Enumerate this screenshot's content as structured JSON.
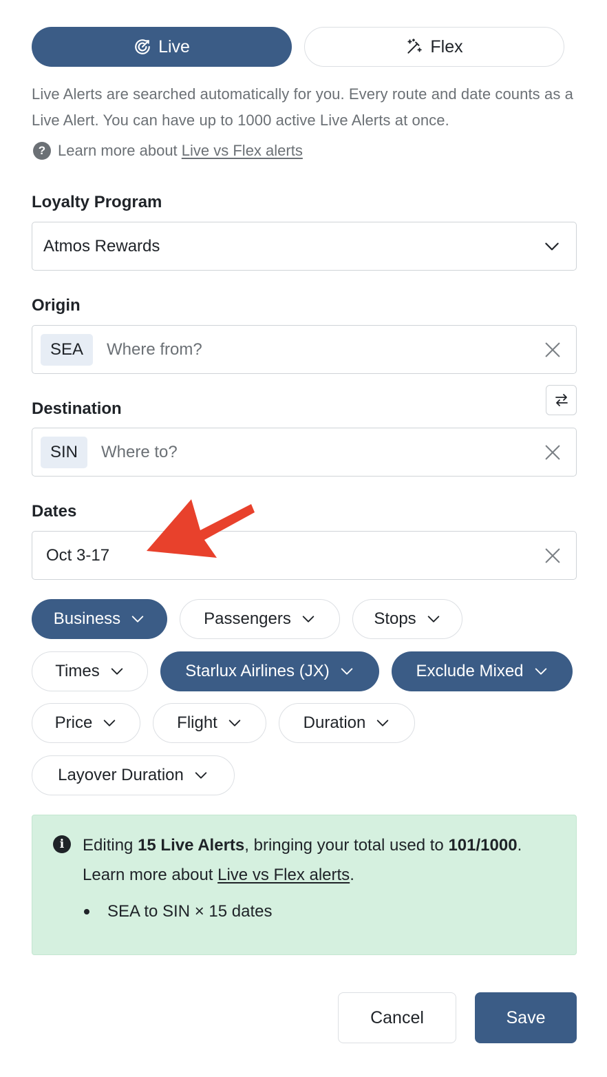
{
  "mode_toggle": {
    "live_label": "Live",
    "flex_label": "Flex"
  },
  "description": "Live Alerts are searched automatically for you. Every route and date counts as a Live Alert. You can have up to 1000 active Live Alerts at once.",
  "learn_more": {
    "prefix": "Learn more about ",
    "link_text": "Live vs Flex alerts"
  },
  "loyalty_program": {
    "label": "Loyalty Program",
    "value": "Atmos Rewards"
  },
  "origin": {
    "label": "Origin",
    "chip": "SEA",
    "placeholder": "Where from?"
  },
  "destination": {
    "label": "Destination",
    "chip": "SIN",
    "placeholder": "Where to?"
  },
  "dates": {
    "label": "Dates",
    "value": "Oct 3-17"
  },
  "filters": [
    {
      "label": "Business",
      "active": true
    },
    {
      "label": "Passengers",
      "active": false
    },
    {
      "label": "Stops",
      "active": false
    },
    {
      "label": "Times",
      "active": false
    },
    {
      "label": "Starlux Airlines (JX)",
      "active": true
    },
    {
      "label": "Exclude Mixed",
      "active": true
    },
    {
      "label": "Price",
      "active": false
    },
    {
      "label": "Flight",
      "active": false
    },
    {
      "label": "Duration",
      "active": false
    },
    {
      "label": "Layover Duration",
      "active": false
    }
  ],
  "info_box": {
    "editing_prefix": "Editing ",
    "editing_count": "15 Live Alerts",
    "editing_middle": ", bringing your total used to ",
    "total_used": "101/1000",
    "period": ".",
    "learn_prefix": "Learn more about ",
    "learn_link": "Live vs Flex alerts",
    "learn_suffix": ".",
    "items": [
      "SEA to SIN × 15 dates"
    ]
  },
  "actions": {
    "cancel_label": "Cancel",
    "save_label": "Save"
  },
  "colors": {
    "primary": "#3b5c86",
    "info_bg": "#d5f0df",
    "annotation_arrow": "#e8412c"
  }
}
